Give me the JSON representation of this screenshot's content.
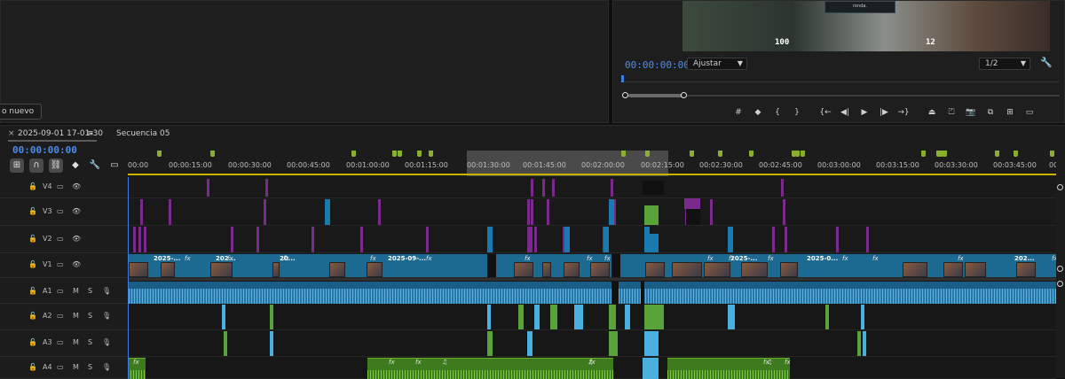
{
  "left_panel": {
    "new_item_label": "o nuevo"
  },
  "program": {
    "timecode": "00:00:00:00",
    "fit_value": "Ajustar",
    "resolution_value": "1/2",
    "hud_health": "100",
    "hud_ammo": "12",
    "hud_message": "ronda.",
    "transport_icons": [
      "marker-icon",
      "mark-in-icon",
      "mark-out-icon",
      "go-to-in-icon",
      "step-back-icon",
      "play-icon",
      "step-forward-icon",
      "go-to-out-icon",
      "lift-icon",
      "extract-icon",
      "export-frame-icon",
      "comparison-icon",
      "safe-margins-icon"
    ]
  },
  "timeline": {
    "tabs": {
      "close": "×",
      "active_sequence": "2025-09-01 17-01-30",
      "menu": "≡",
      "other_sequence": "Secuencia 05"
    },
    "timecode": "00:00:00:00",
    "ruler_labels": [
      "00:00",
      "00:00:15:00",
      "00:00:30:00",
      "00:00:45:00",
      "00:01:00:00",
      "00:01:15:00",
      "00:01:30:00",
      "00:01:45:00",
      "00:02:00:00",
      "00:02:15:00",
      "00:02:30:00",
      "00:02:45:00",
      "00:03:00:00",
      "00:03:15:00",
      "00:03:30:00",
      "00:03:45:00",
      "00"
    ],
    "video_tracks": [
      {
        "name": "V4"
      },
      {
        "name": "V3"
      },
      {
        "name": "V2"
      },
      {
        "name": "V1"
      }
    ],
    "audio_tracks": [
      {
        "name": "A1",
        "m": "M",
        "s": "S"
      },
      {
        "name": "A2",
        "m": "M",
        "s": "S"
      },
      {
        "name": "A3",
        "m": "M",
        "s": "S"
      },
      {
        "name": "A4",
        "m": "M",
        "s": "S"
      }
    ],
    "v1_clip_labels": [
      "2025-...",
      "202...",
      "20...",
      "2025-09-...",
      "2025-...",
      "2025-0...",
      "202..."
    ],
    "fx_label": "fx",
    "note_label": "♫"
  },
  "colors": {
    "accent_blue": "#4a8df0",
    "video_clip": "#1c6a92",
    "adjust_purple": "#7a2a8a",
    "audio_green": "#58a33a",
    "marker_green": "#8ab030",
    "ruler_yellow": "#c9b400"
  }
}
